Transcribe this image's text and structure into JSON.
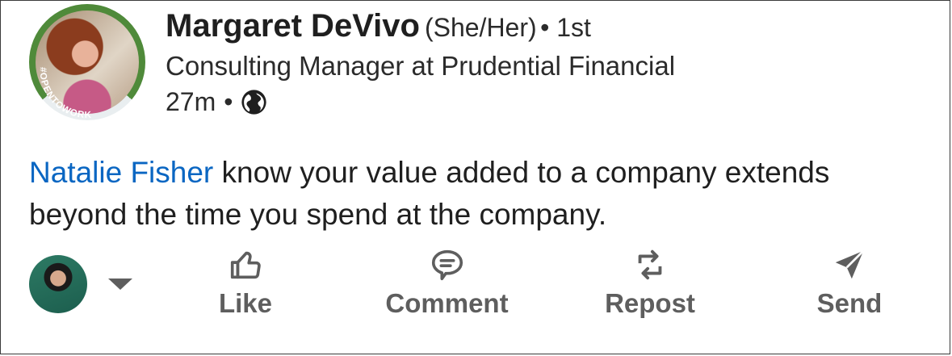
{
  "author": {
    "name": "Margaret DeVivo",
    "pronouns": "(She/Her)",
    "degree": "• 1st",
    "headline": "Consulting Manager at Prudential Financial",
    "time": "27m",
    "meta_separator": "•",
    "visibility_icon": "globe-icon",
    "badge_text": "#OPENTOWORK",
    "badge_color": "#4f8a3a"
  },
  "post": {
    "mention": "Natalie Fisher",
    "text": " know your value added to a company extends beyond the time you spend at the company."
  },
  "actions": {
    "like": "Like",
    "comment": "Comment",
    "repost": "Repost",
    "send": "Send"
  },
  "colors": {
    "mention": "#0a66c2",
    "action": "#5e5e5e"
  }
}
